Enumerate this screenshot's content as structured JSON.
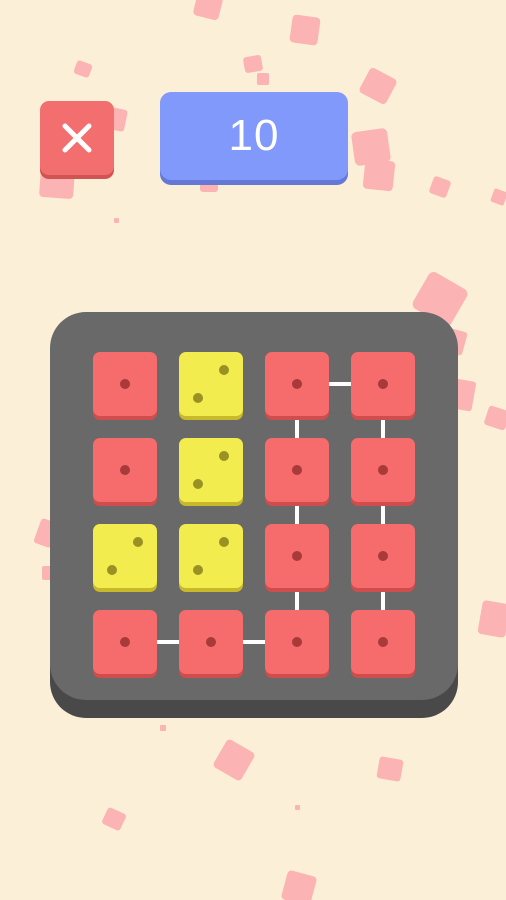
{
  "counter": {
    "value": "10"
  },
  "colors": {
    "background": "#fcefd8",
    "tile_red": "#f66b6b",
    "tile_yellow": "#f2ec4e",
    "board": "#696969",
    "counter": "#8199fa",
    "close": "#f36e6e",
    "confetti": "#fbb3b3"
  },
  "icons": {
    "close": "close-icon",
    "die_one": "die-one-icon",
    "die_two": "die-two-icon"
  },
  "board": {
    "rows": 4,
    "cols": 4,
    "tiles": [
      [
        "red-1",
        "yellow-2",
        "red-1",
        "red-1"
      ],
      [
        "red-1",
        "yellow-2",
        "red-1",
        "red-1"
      ],
      [
        "yellow-2",
        "yellow-2",
        "red-1",
        "red-1"
      ],
      [
        "red-1",
        "red-1",
        "red-1",
        "red-1"
      ]
    ],
    "links": [
      [
        [
          0,
          2
        ],
        [
          0,
          3
        ]
      ],
      [
        [
          0,
          2
        ],
        [
          1,
          2
        ]
      ],
      [
        [
          1,
          2
        ],
        [
          2,
          2
        ]
      ],
      [
        [
          2,
          2
        ],
        [
          3,
          2
        ]
      ],
      [
        [
          0,
          3
        ],
        [
          1,
          3
        ]
      ],
      [
        [
          1,
          3
        ],
        [
          2,
          3
        ]
      ],
      [
        [
          2,
          3
        ],
        [
          3,
          3
        ]
      ],
      [
        [
          3,
          0
        ],
        [
          3,
          1
        ]
      ],
      [
        [
          3,
          1
        ],
        [
          3,
          2
        ]
      ]
    ]
  }
}
